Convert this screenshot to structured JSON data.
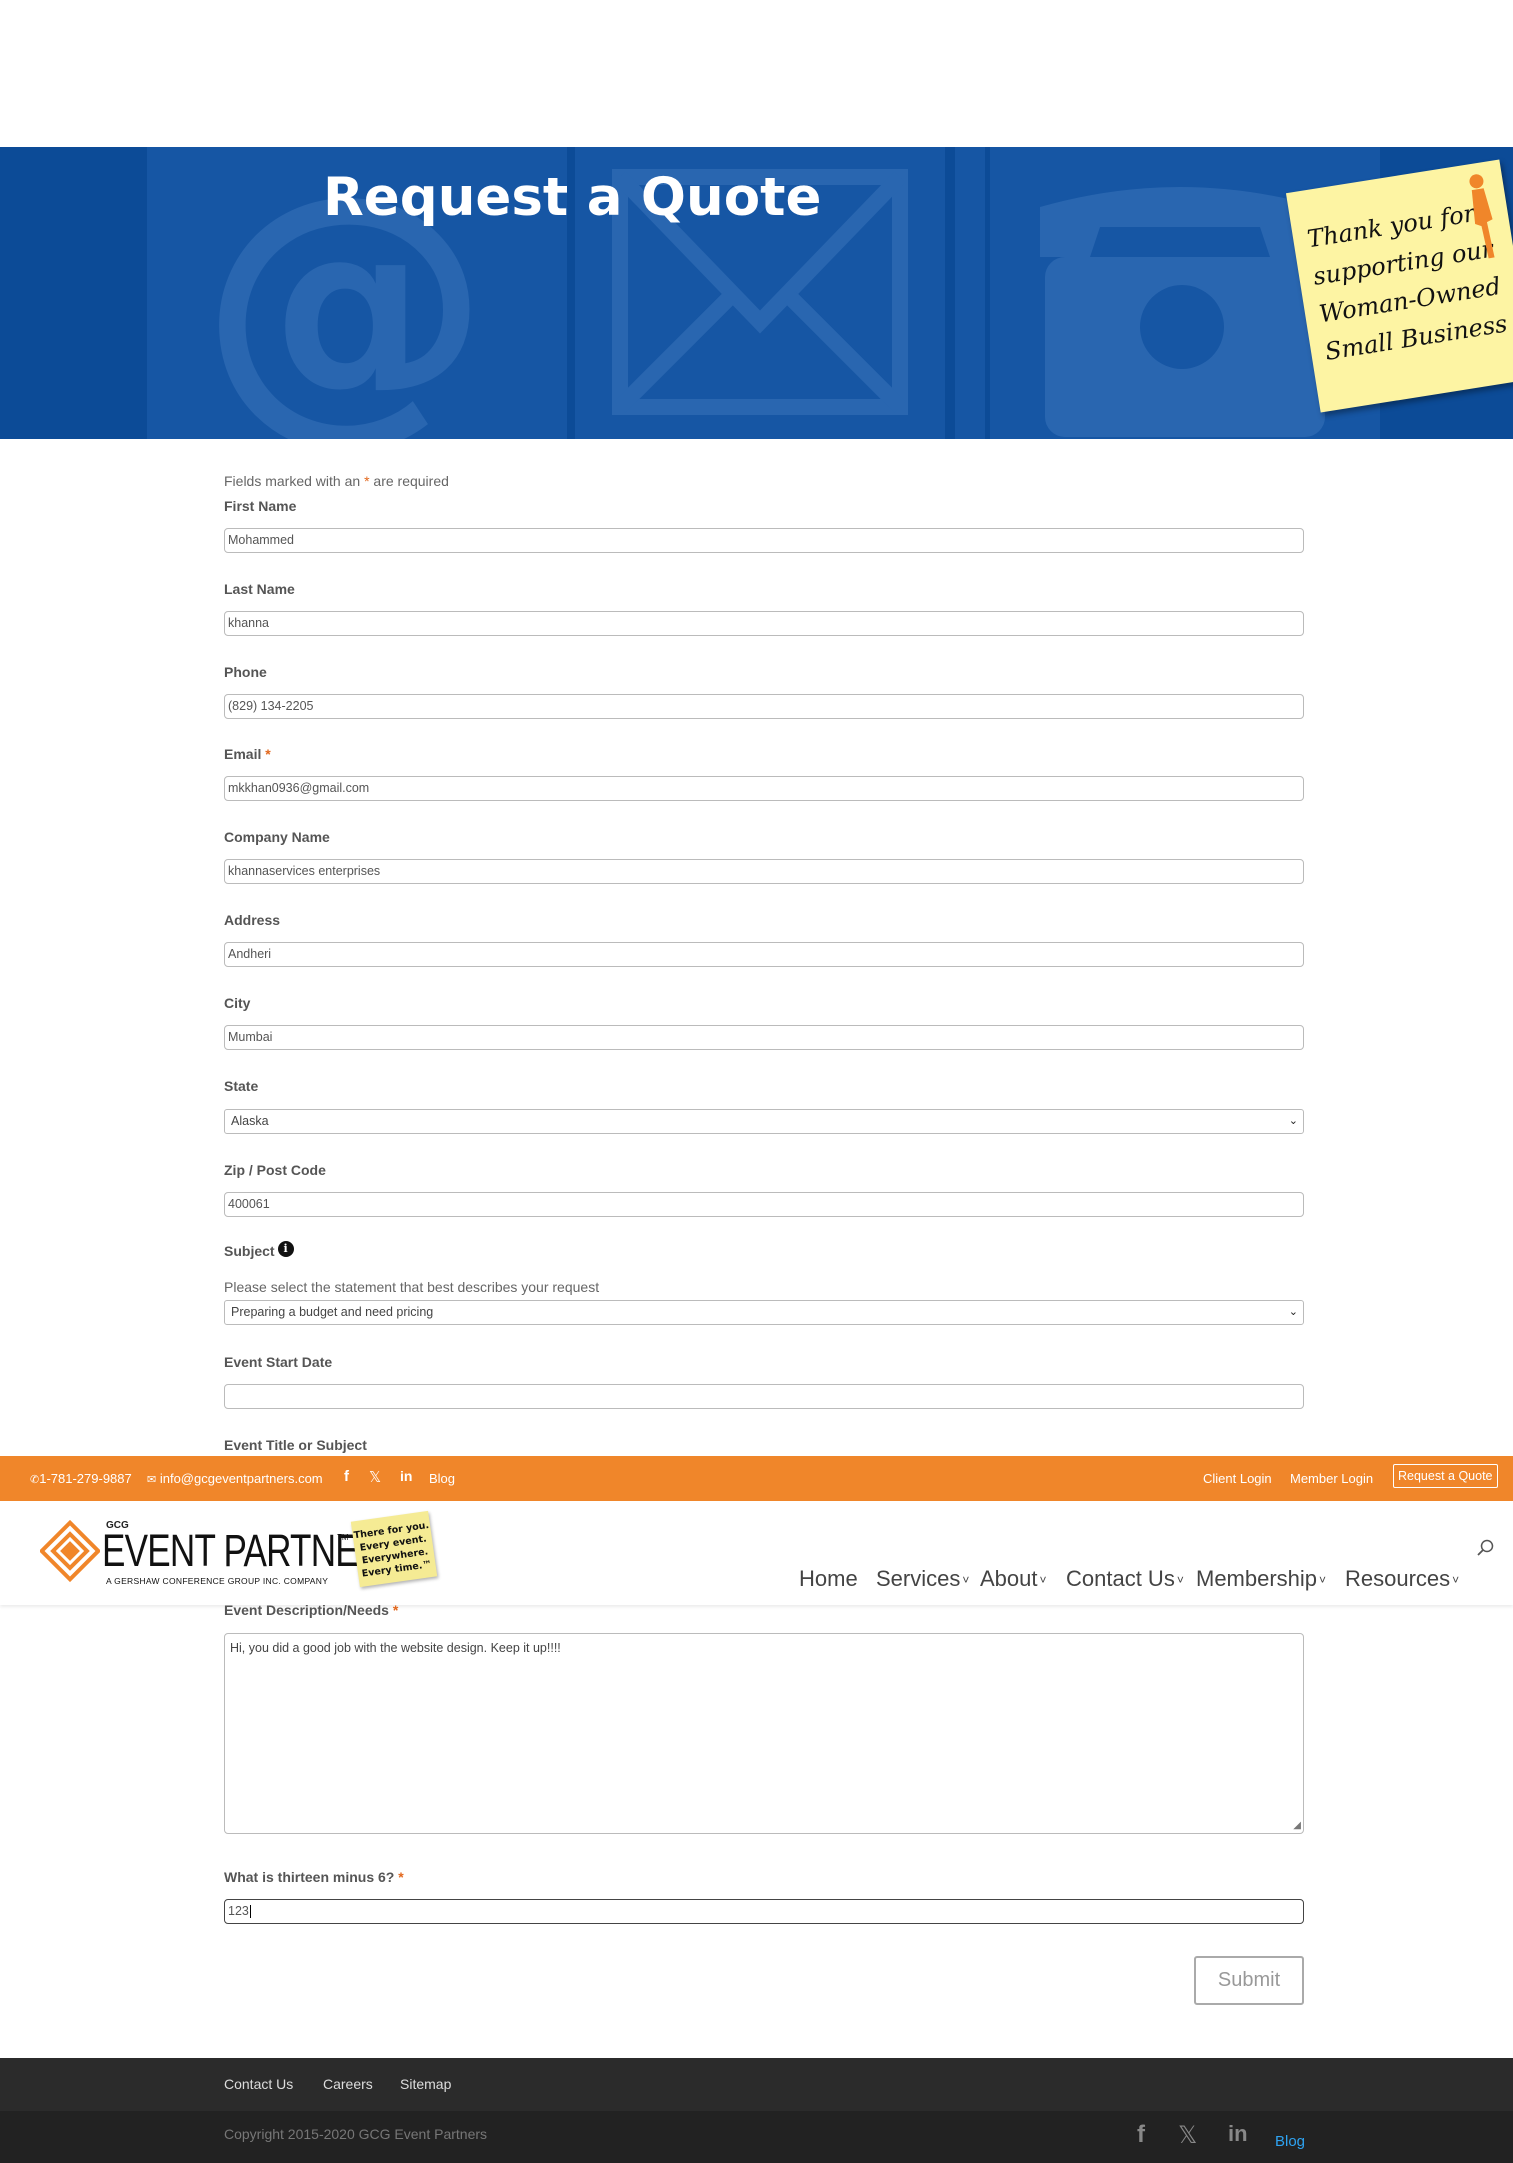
{
  "hero": {
    "title": "Request a Quote",
    "sticky_note": [
      "Thank you for",
      "supporting our",
      "Woman-Owned",
      "Small Business"
    ]
  },
  "form": {
    "required_note_before": "Fields marked with an",
    "required_asterisk": "*",
    "required_note_after": "are required",
    "fields": {
      "first_name": {
        "label": "First Name",
        "value": "Mohammed"
      },
      "last_name": {
        "label": "Last Name",
        "value": "khanna"
      },
      "phone": {
        "label": "Phone",
        "value": "(829) 134-2205"
      },
      "email": {
        "label": "Email",
        "required": "*",
        "value": "mkkhan0936@gmail.com"
      },
      "company": {
        "label": "Company Name",
        "value": "khannaservices enterprises"
      },
      "address": {
        "label": "Address",
        "value": "Andheri"
      },
      "city": {
        "label": "City",
        "value": "Mumbai"
      },
      "state": {
        "label": "State",
        "value": "Alaska"
      },
      "zip": {
        "label": "Zip / Post Code",
        "value": "400061"
      },
      "subject": {
        "label": "Subject",
        "help": "Please select the statement that best describes your request",
        "value": "Preparing a budget and need pricing"
      },
      "event_start": {
        "label": "Event Start Date",
        "value": ""
      },
      "event_title": {
        "label": "Event Title or Subject"
      },
      "description": {
        "label": "Event Description/Needs",
        "required": "*",
        "value": "Hi, you did a good job with the website design. Keep it up!!!!"
      },
      "captcha": {
        "label": "What is thirteen minus 6?",
        "required": "*",
        "value": "123"
      }
    },
    "submit_label": "Submit"
  },
  "topbar": {
    "phone": "1-781-279-9887",
    "email": "info@gcgeventpartners.com",
    "blog": "Blog",
    "client_login": "Client Login",
    "member_login": "Member Login",
    "request_quote": "Request a Quote",
    "background": "#f0862a"
  },
  "header": {
    "logo": {
      "gcg": "GCG",
      "name": "EVENT PARTNERS",
      "tm": "TM",
      "tagline": "A GERSHAW CONFERENCE GROUP INC. COMPANY"
    },
    "note": [
      "There for you.",
      "Every event.",
      "Everywhere.",
      "Every time.™"
    ],
    "nav": [
      "Home",
      "Services",
      "About",
      "Contact Us",
      "Membership",
      "Resources"
    ]
  },
  "footer": {
    "links": [
      "Contact Us",
      "Careers",
      "Sitemap"
    ],
    "copyright": "Copyright 2015-2020 GCG Event Partners",
    "blog": "Blog"
  },
  "icons": {
    "info": "i",
    "dropdown": "⌄",
    "nav_caret": "˅"
  }
}
